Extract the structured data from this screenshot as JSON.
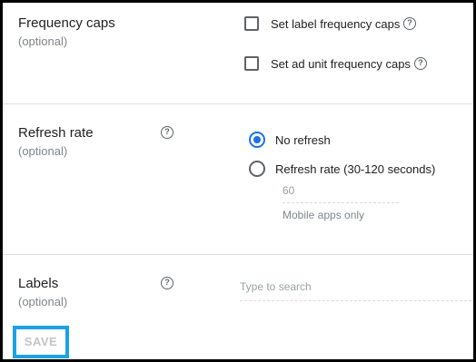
{
  "frequency_caps": {
    "title": "Frequency caps",
    "subtitle": "(optional)",
    "options": [
      {
        "label": "Set label frequency caps",
        "checked": false
      },
      {
        "label": "Set ad unit frequency caps",
        "checked": false
      }
    ]
  },
  "refresh_rate": {
    "title": "Refresh rate",
    "subtitle": "(optional)",
    "options": [
      {
        "label": "No refresh",
        "selected": true
      },
      {
        "label": "Refresh rate (30-120 seconds)",
        "selected": false
      }
    ],
    "seconds_value": "60",
    "hint": "Mobile apps only"
  },
  "labels": {
    "title": "Labels",
    "subtitle": "(optional)",
    "search_placeholder": "Type to search"
  },
  "save_button": {
    "label": "SAVE",
    "enabled": false
  },
  "colors": {
    "accent": "#1a73e8",
    "highlight_outline": "#1da1e6",
    "disabled_text": "#c4c4c4"
  },
  "icons": [
    "help-icon",
    "checkbox-icon",
    "radio-icon"
  ]
}
